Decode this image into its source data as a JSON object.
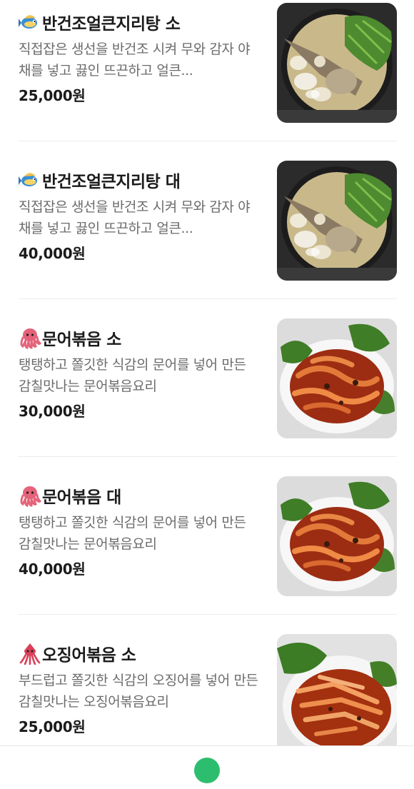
{
  "menu": {
    "items": [
      {
        "name": "반건조얼큰지리탕 소",
        "description": "직접잡은 생선을 반건조 시켜 무와 감자 야채를 넣고 끓인 뜨끈하고 얼큰...",
        "price": "25,000원",
        "emoji_icon": "fish-icon",
        "image_icon": "fish-stew-photo"
      },
      {
        "name": "반건조얼큰지리탕 대",
        "description": "직접잡은 생선을 반건조 시켜 무와 감자 야채를 넣고 끓인 뜨끈하고 얼큰...",
        "price": "40,000원",
        "emoji_icon": "fish-icon",
        "image_icon": "fish-stew-photo"
      },
      {
        "name": "문어볶음 소",
        "description": "탱탱하고 쫄깃한 식감의 문어를 넣어 만든 감칠맛나는 문어볶음요리",
        "price": "30,000원",
        "emoji_icon": "octopus-icon",
        "image_icon": "stir-fried-octopus-photo"
      },
      {
        "name": "문어볶음 대",
        "description": "탱탱하고 쫄깃한 식감의 문어를 넣어 만든 감칠맛나는 문어볶음요리",
        "price": "40,000원",
        "emoji_icon": "octopus-icon",
        "image_icon": "stir-fried-octopus-photo"
      },
      {
        "name": "오징어볶음 소",
        "description": "부드럽고 쫄깃한 식감의 오징어를 넣어 만든 감칠맛나는 오징어볶음요리",
        "price": "25,000원",
        "emoji_icon": "squid-icon",
        "image_icon": "stir-fried-squid-photo"
      }
    ]
  },
  "colors": {
    "text_primary": "#1b1b1b",
    "text_secondary": "#6b6b6b",
    "divider": "#ececec",
    "accent_green": "#2dbd6e"
  }
}
